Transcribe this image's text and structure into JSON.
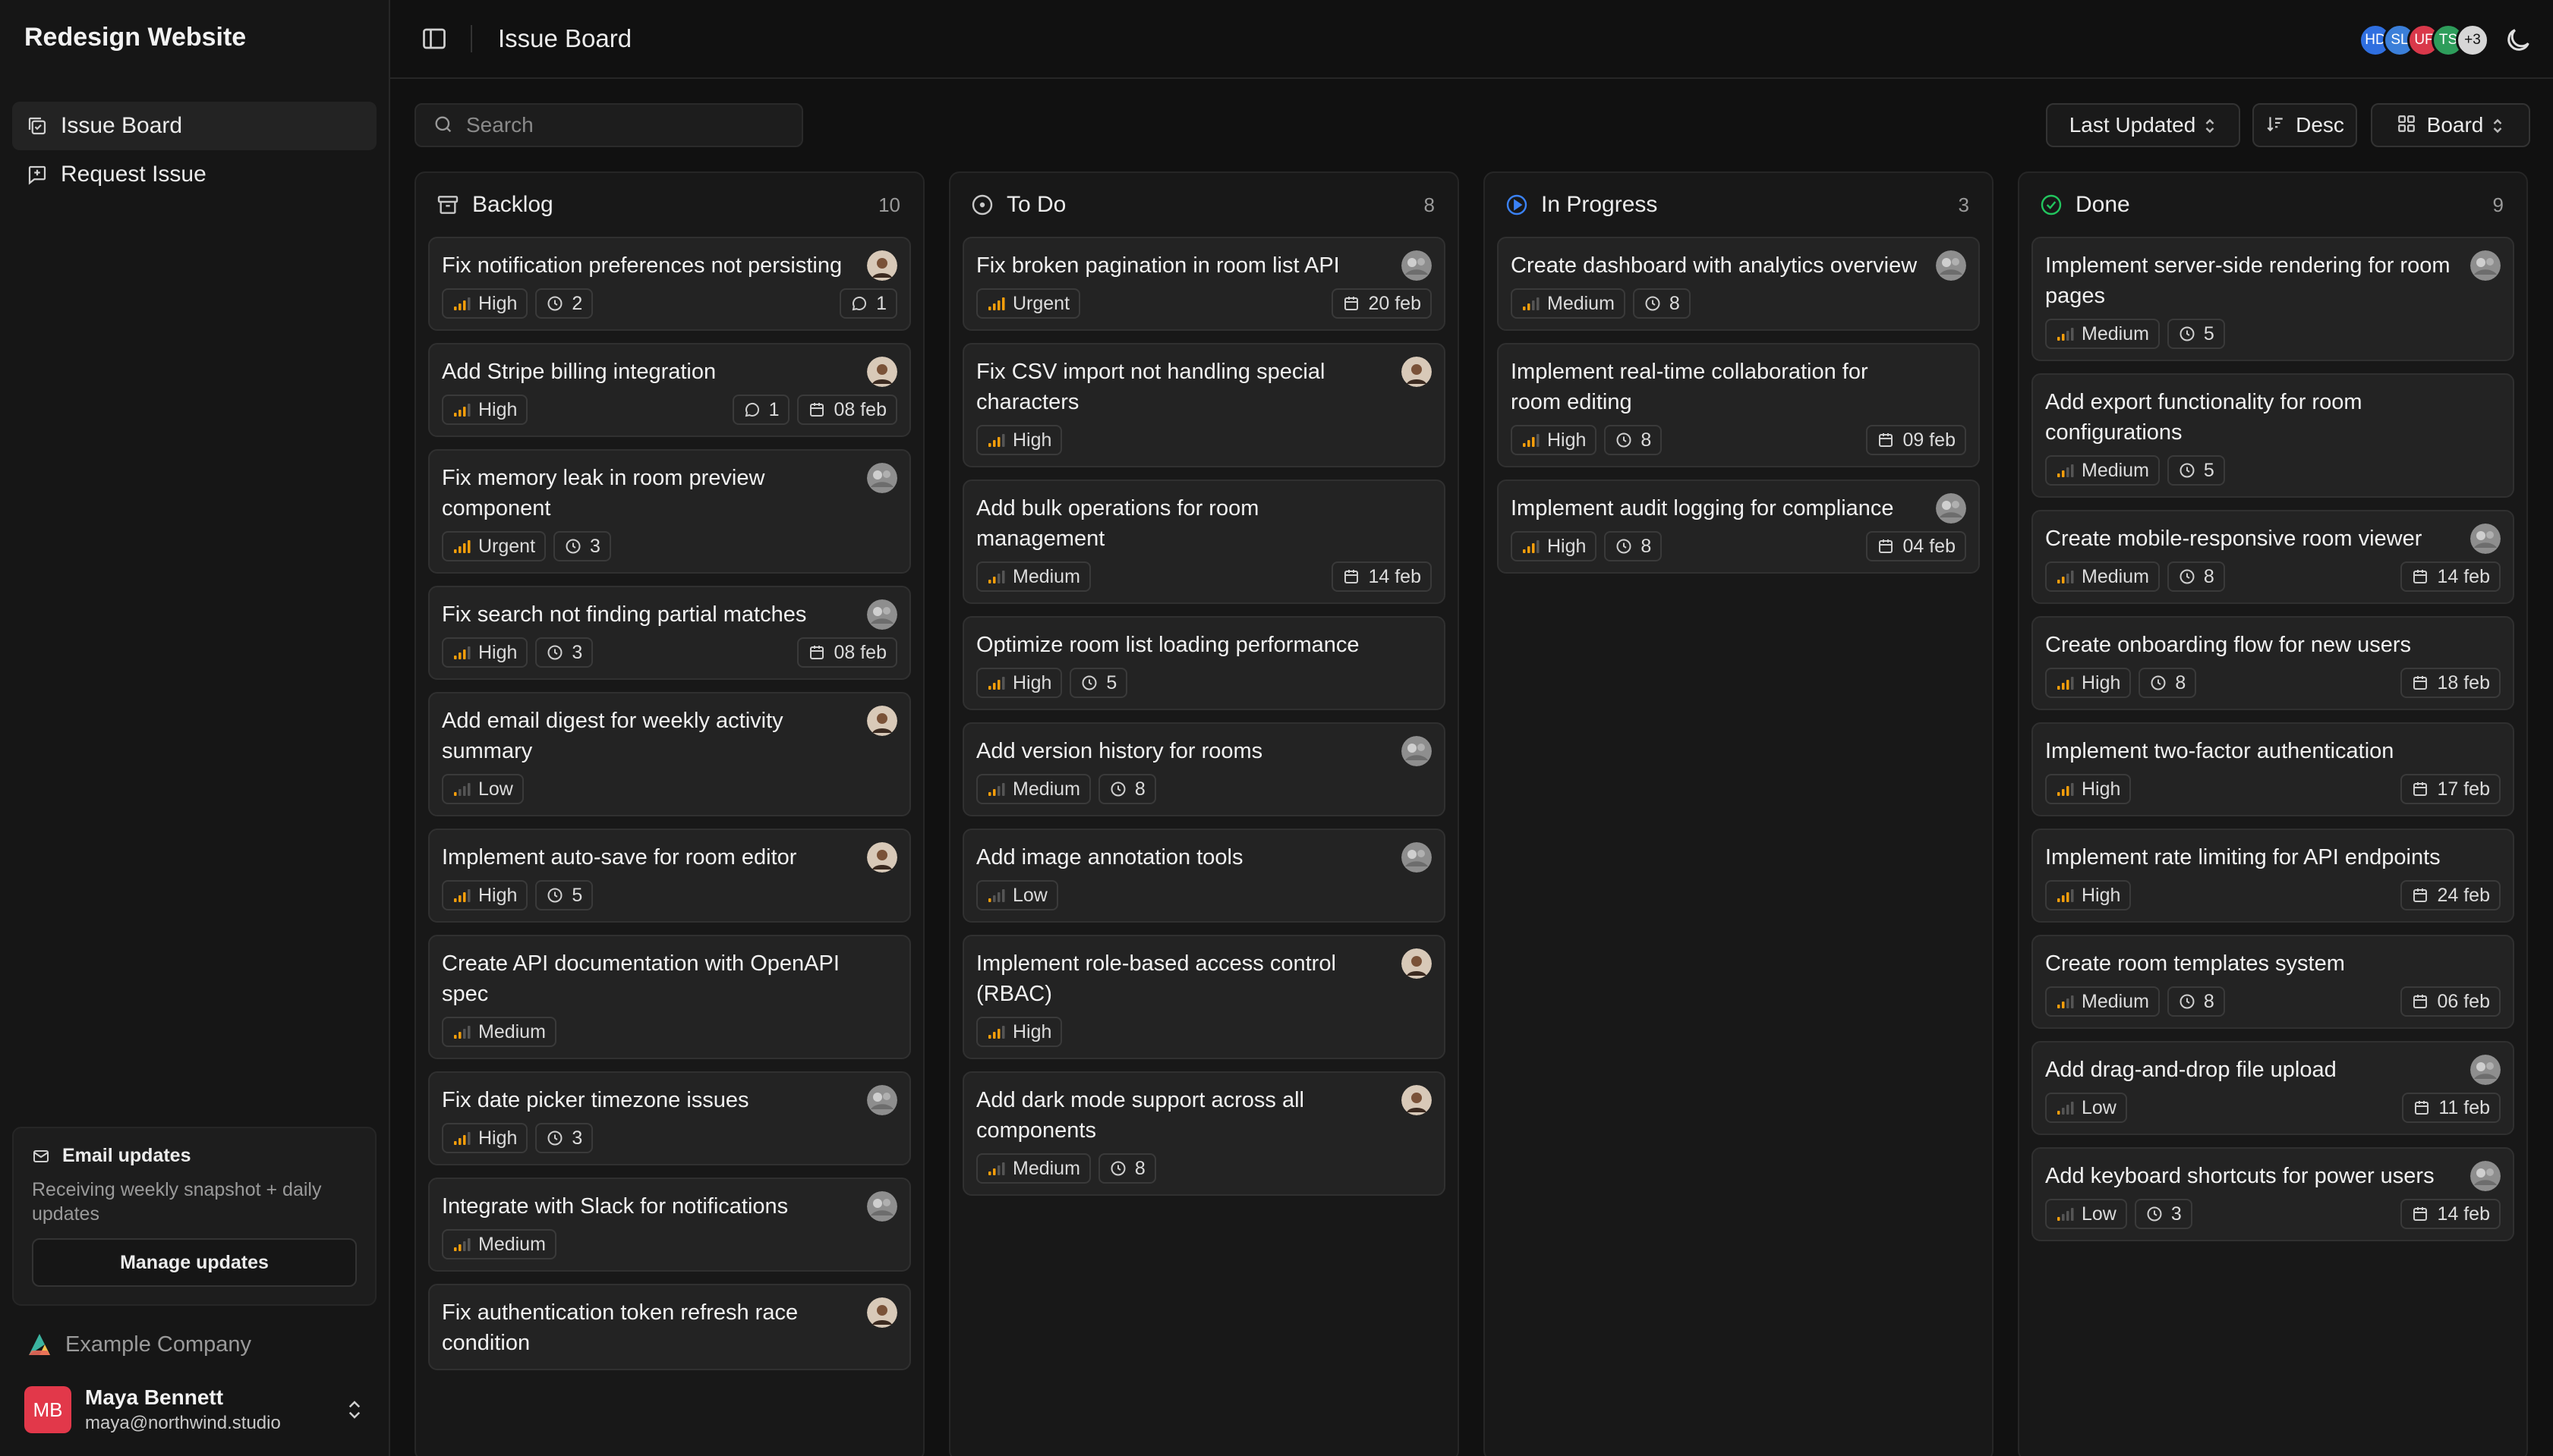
{
  "sidebar": {
    "brand": "Redesign Website",
    "nav": [
      {
        "label": "Issue Board",
        "icon": "board-icon",
        "active": true
      },
      {
        "label": "Request Issue",
        "icon": "request-icon",
        "active": false
      }
    ],
    "email": {
      "title": "Email updates",
      "description": "Receiving weekly snapshot + daily updates",
      "button": "Manage updates"
    },
    "company": "Example Company",
    "user": {
      "initials": "MB",
      "name": "Maya Bennett",
      "email": "maya@northwind.studio"
    }
  },
  "header": {
    "title": "Issue Board",
    "avatars": [
      {
        "initials": "HD",
        "color": "#2f6fe0"
      },
      {
        "initials": "SL",
        "color": "#3b7fd9"
      },
      {
        "initials": "UF",
        "color": "#d9384a"
      },
      {
        "initials": "TS",
        "color": "#2e9d5b"
      },
      {
        "initials": "+3",
        "color": "#d6d6d6"
      }
    ]
  },
  "toolbar": {
    "search_placeholder": "Search",
    "sort_label": "Last Updated",
    "order_label": "Desc",
    "view_label": "Board"
  },
  "colors": {
    "accent_blue": "#3b82f6",
    "done_green": "#22c55e",
    "priority_bar": "#f59e0b"
  },
  "columns": [
    {
      "title": "Backlog",
      "count": "10",
      "icon": "archive-icon",
      "cards": [
        {
          "title": "Fix notification preferences not persisting",
          "priority": "High",
          "points": "2",
          "comments": "1",
          "due": "",
          "avatar": "photo"
        },
        {
          "title": "Add Stripe billing integration",
          "priority": "High",
          "points": "",
          "comments": "1",
          "due": "08 feb",
          "avatar": "photo"
        },
        {
          "title": "Fix memory leak in room preview component",
          "priority": "Urgent",
          "points": "3",
          "comments": "",
          "due": "",
          "avatar": "gray"
        },
        {
          "title": "Fix search not finding partial matches",
          "priority": "High",
          "points": "3",
          "comments": "",
          "due": "08 feb",
          "avatar": "gray"
        },
        {
          "title": "Add email digest for weekly activity summary",
          "priority": "Low",
          "points": "",
          "comments": "",
          "due": "",
          "avatar": "photo"
        },
        {
          "title": "Implement auto-save for room editor",
          "priority": "High",
          "points": "5",
          "comments": "",
          "due": "",
          "avatar": "photo"
        },
        {
          "title": "Create API documentation with OpenAPI spec",
          "priority": "Medium",
          "points": "",
          "comments": "",
          "due": "",
          "avatar": ""
        },
        {
          "title": "Fix date picker timezone issues",
          "priority": "High",
          "points": "3",
          "comments": "",
          "due": "",
          "avatar": "gray"
        },
        {
          "title": "Integrate with Slack for notifications",
          "priority": "Medium",
          "points": "",
          "comments": "",
          "due": "",
          "avatar": "gray"
        },
        {
          "title": "Fix authentication token refresh race condition",
          "priority": "",
          "points": "",
          "comments": "",
          "due": "",
          "avatar": "photo"
        }
      ]
    },
    {
      "title": "To Do",
      "count": "8",
      "icon": "circle-dot-icon",
      "cards": [
        {
          "title": "Fix broken pagination in room list API",
          "priority": "Urgent",
          "points": "",
          "comments": "",
          "due": "20 feb",
          "avatar": "gray"
        },
        {
          "title": "Fix CSV import not handling special characters",
          "priority": "High",
          "points": "",
          "comments": "",
          "due": "",
          "avatar": "photo"
        },
        {
          "title": "Add bulk operations for room management",
          "priority": "Medium",
          "points": "",
          "comments": "",
          "due": "14 feb",
          "avatar": ""
        },
        {
          "title": "Optimize room list loading performance",
          "priority": "High",
          "points": "5",
          "comments": "",
          "due": "",
          "avatar": ""
        },
        {
          "title": "Add version history for rooms",
          "priority": "Medium",
          "points": "8",
          "comments": "",
          "due": "",
          "avatar": "gray"
        },
        {
          "title": "Add image annotation tools",
          "priority": "Low",
          "points": "",
          "comments": "",
          "due": "",
          "avatar": "gray"
        },
        {
          "title": "Implement role-based access control (RBAC)",
          "priority": "High",
          "points": "",
          "comments": "",
          "due": "",
          "avatar": "photo"
        },
        {
          "title": "Add dark mode support across all components",
          "priority": "Medium",
          "points": "8",
          "comments": "",
          "due": "",
          "avatar": "photo"
        }
      ]
    },
    {
      "title": "In Progress",
      "count": "3",
      "icon": "play-circle-icon",
      "cards": [
        {
          "title": "Create dashboard with analytics overview",
          "priority": "Medium",
          "points": "8",
          "comments": "",
          "due": "",
          "avatar": "gray"
        },
        {
          "title": "Implement real-time collaboration for room editing",
          "priority": "High",
          "points": "8",
          "comments": "",
          "due": "09 feb",
          "avatar": ""
        },
        {
          "title": "Implement audit logging for compliance",
          "priority": "High",
          "points": "8",
          "comments": "",
          "due": "04 feb",
          "avatar": "gray"
        }
      ]
    },
    {
      "title": "Done",
      "count": "9",
      "icon": "check-circle-icon",
      "cards": [
        {
          "title": "Implement server-side rendering for room pages",
          "priority": "Medium",
          "points": "5",
          "comments": "",
          "due": "",
          "avatar": "gray"
        },
        {
          "title": "Add export functionality for room configurations",
          "priority": "Medium",
          "points": "5",
          "comments": "",
          "due": "",
          "avatar": ""
        },
        {
          "title": "Create mobile-responsive room viewer",
          "priority": "Medium",
          "points": "8",
          "comments": "",
          "due": "14 feb",
          "avatar": "gray"
        },
        {
          "title": "Create onboarding flow for new users",
          "priority": "High",
          "points": "8",
          "comments": "",
          "due": "18 feb",
          "avatar": ""
        },
        {
          "title": "Implement two-factor authentication",
          "priority": "High",
          "points": "",
          "comments": "",
          "due": "17 feb",
          "avatar": ""
        },
        {
          "title": "Implement rate limiting for API endpoints",
          "priority": "High",
          "points": "",
          "comments": "",
          "due": "24 feb",
          "avatar": ""
        },
        {
          "title": "Create room templates system",
          "priority": "Medium",
          "points": "8",
          "comments": "",
          "due": "06 feb",
          "avatar": ""
        },
        {
          "title": "Add drag-and-drop file upload",
          "priority": "Low",
          "points": "",
          "comments": "",
          "due": "11 feb",
          "avatar": "gray"
        },
        {
          "title": "Add keyboard shortcuts for power users",
          "priority": "Low",
          "points": "3",
          "comments": "",
          "due": "14 feb",
          "avatar": "gray"
        }
      ]
    }
  ]
}
